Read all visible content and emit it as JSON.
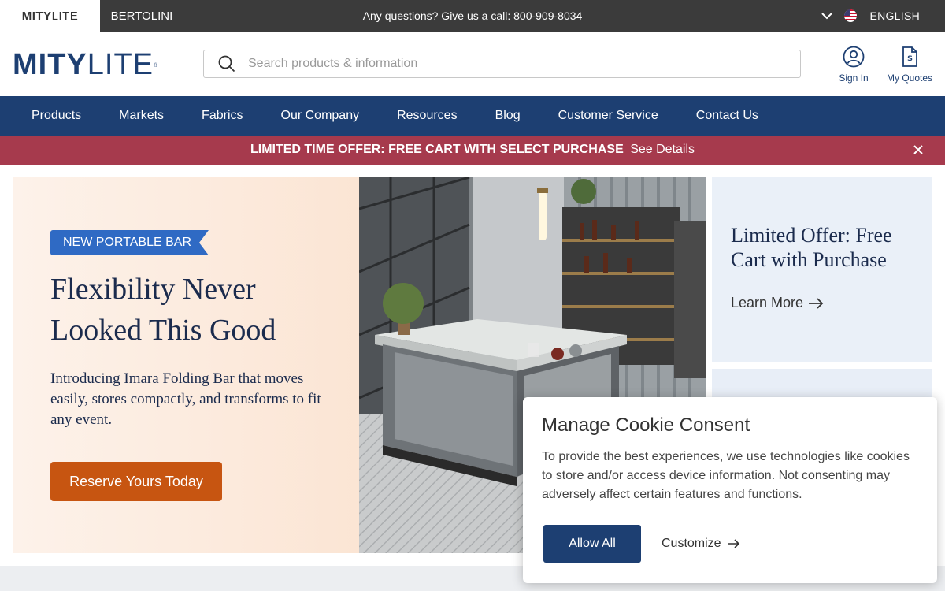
{
  "topbar": {
    "brand_active_bold": "MITY",
    "brand_active_light": "LITE",
    "brand_other": "BERTOLINI",
    "phone_text": "Any questions? Give us a call: 800-909-8034",
    "language": "ENGLISH"
  },
  "header": {
    "logo_bold": "MITY",
    "logo_light": "LITE",
    "search_placeholder": "Search products & information",
    "sign_in": "Sign In",
    "my_quotes": "My Quotes"
  },
  "nav": {
    "items": [
      "Products",
      "Markets",
      "Fabrics",
      "Our Company",
      "Resources",
      "Blog",
      "Customer Service",
      "Contact Us"
    ]
  },
  "promo": {
    "text": "LIMITED TIME OFFER: FREE CART WITH SELECT PURCHASE",
    "link": "See Details"
  },
  "hero": {
    "badge": "NEW PORTABLE BAR",
    "title": "Flexibility Never Looked This Good",
    "description": "Introducing Imara Folding Bar that moves easily, stores compactly, and transforms to fit any event.",
    "cta": "Reserve Yours Today"
  },
  "side_card": {
    "title": "Limited Offer: Free Cart with Purchase",
    "link": "Learn More"
  },
  "cookie": {
    "title": "Manage Cookie Consent",
    "body": "To provide the best experiences, we use technologies like cookies to store and/or access device information. Not consenting may adversely affect certain features and functions.",
    "allow": "Allow All",
    "customize": "Customize"
  },
  "colors": {
    "brand_navy": "#1d3f72",
    "promo_red": "#a63a4d",
    "cta_orange": "#c75511",
    "badge_blue": "#2f6ac4"
  }
}
